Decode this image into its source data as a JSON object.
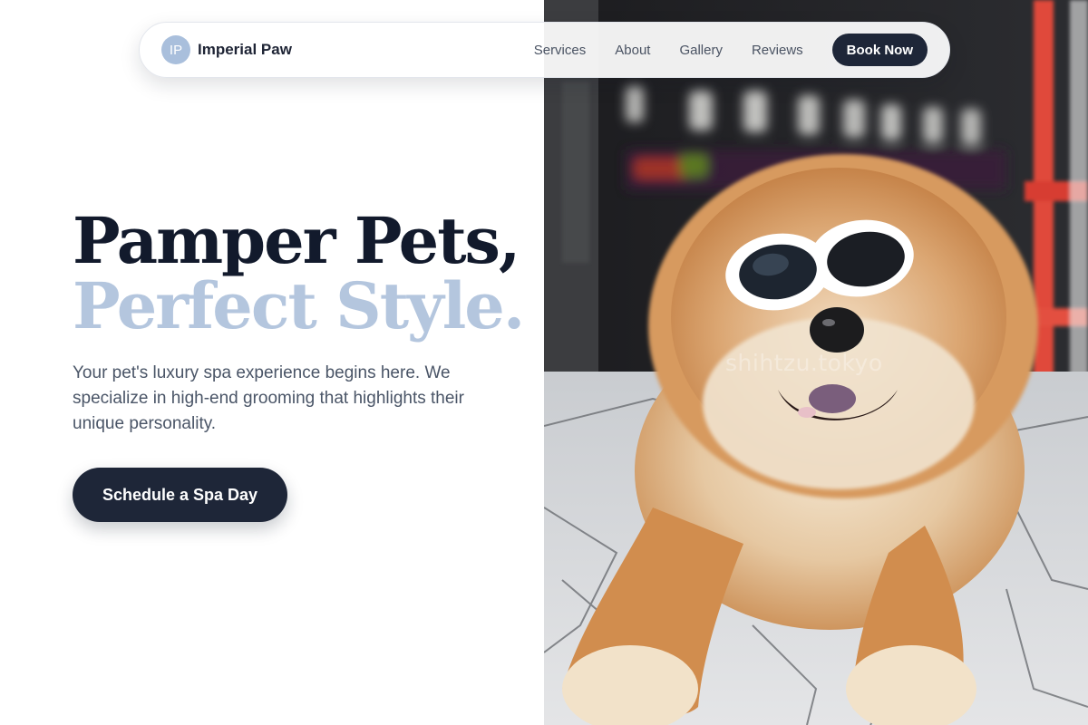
{
  "nav": {
    "brand_initials": "IP",
    "brand_name": "Imperial Paw",
    "links": [
      "Services",
      "About",
      "Gallery",
      "Reviews"
    ],
    "cta": "Book Now"
  },
  "hero": {
    "headline_line1": "Pamper Pets,",
    "headline_line2": "Perfect Style.",
    "description": "Your pet's luxury spa experience begins here. We specialize in high-end grooming that highlights their unique personality.",
    "cta": "Schedule a Spa Day"
  },
  "photo": {
    "watermark": "shihtzu.tokyo",
    "subject": "fluffy dog wearing white sunglasses"
  },
  "colors": {
    "navy": "#1e2638",
    "accent_blue": "#b4c6de",
    "heading": "#121a2c",
    "body_text": "#4a5567"
  }
}
